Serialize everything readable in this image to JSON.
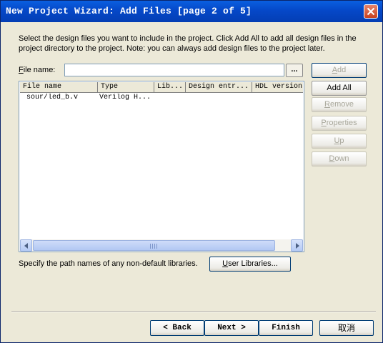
{
  "window": {
    "title": "New Project Wizard: Add Files [page 2 of 5]"
  },
  "description": "Select the design files you want to include in the project. Click Add All to add all design files in the project directory to the project. Note: you can always add design files to the project later.",
  "file_name": {
    "label_hotkey": "F",
    "label_rest": "ile name:",
    "value": "",
    "browse_label": "..."
  },
  "file_list": {
    "columns": [
      "File name",
      "Type",
      "Lib...",
      "Design entr...",
      "HDL version"
    ],
    "rows": [
      {
        "file_name": "sour/led_b.v",
        "type": "Verilog H...",
        "lib": "",
        "design_entry": "",
        "hdl_version": ""
      }
    ]
  },
  "buttons": {
    "add": {
      "pre": "",
      "hotkey": "A",
      "post": "dd",
      "enabled": false
    },
    "add_all": {
      "label": "Add All",
      "enabled": true
    },
    "remove": {
      "pre": "",
      "hotkey": "R",
      "post": "emove",
      "enabled": false
    },
    "properties": {
      "pre": "",
      "hotkey": "P",
      "post": "roperties",
      "enabled": false
    },
    "up": {
      "pre": "",
      "hotkey": "U",
      "post": "p",
      "enabled": false
    },
    "down": {
      "pre": "",
      "hotkey": "D",
      "post": "own",
      "enabled": false
    }
  },
  "libraries": {
    "text": "Specify the path names of any non-default libraries.",
    "button_pre": "",
    "button_hotkey": "U",
    "button_post": "ser Libraries..."
  },
  "nav": {
    "back": "< Back",
    "next": "Next >",
    "finish": "Finish",
    "cancel": "取消"
  }
}
